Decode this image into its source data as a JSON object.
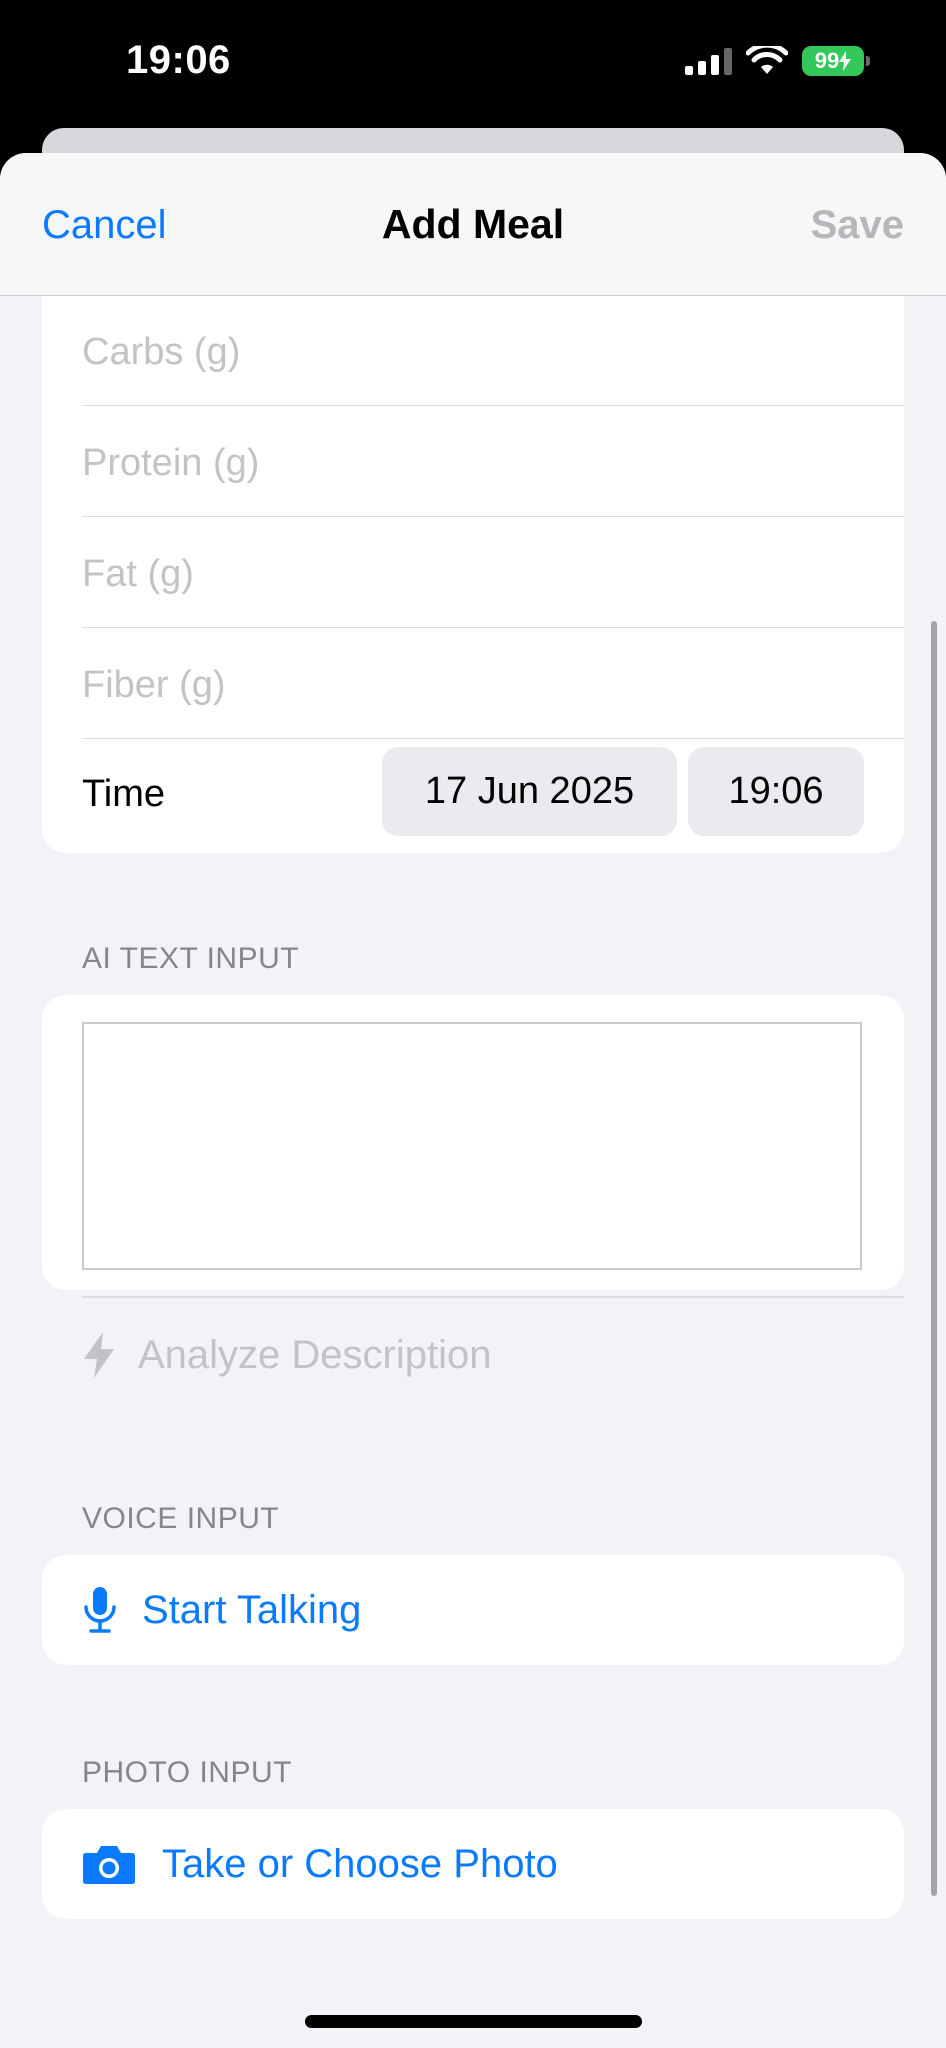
{
  "status_bar": {
    "time": "19:06",
    "battery": "99"
  },
  "nav": {
    "cancel": "Cancel",
    "title": "Add Meal",
    "save": "Save"
  },
  "form": {
    "fields": [
      {
        "placeholder": "Carbs (g)"
      },
      {
        "placeholder": "Protein (g)"
      },
      {
        "placeholder": "Fat (g)"
      },
      {
        "placeholder": "Fiber (g)"
      }
    ],
    "time_label": "Time",
    "date_value": "17 Jun 2025",
    "time_value": "19:06"
  },
  "ai_section": {
    "header": "AI TEXT INPUT",
    "text_value": "",
    "action_label": "Analyze Description"
  },
  "voice_section": {
    "header": "VOICE INPUT",
    "action_label": "Start Talking"
  },
  "photo_section": {
    "header": "PHOTO INPUT",
    "action_label": "Take or Choose Photo"
  },
  "colors": {
    "accent": "#0a7aff",
    "disabled": "#c3c3c7",
    "background": "#f2f2f7",
    "battery": "#34c759"
  },
  "icons": [
    "signal-icon",
    "wifi-icon",
    "battery-icon",
    "bolt-icon",
    "microphone-icon",
    "camera-icon"
  ]
}
